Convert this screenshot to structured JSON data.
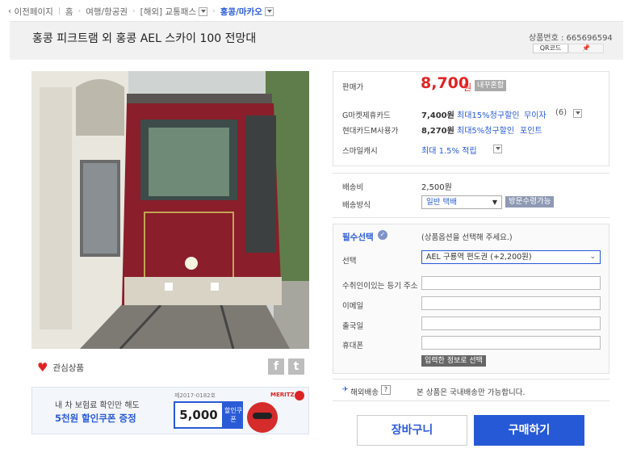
{
  "breadcrumb": {
    "back": "이전페이지",
    "items": [
      "홈",
      "여행/항공권",
      "[해외] 교통패스"
    ],
    "current": "홍콩/마카오"
  },
  "product": {
    "title": "홍콩 피크트램 외 홍콩 AEL 스카이 100 전망대",
    "number": "상품번호 : 665696594",
    "qr_label": "QR코드",
    "pin_label": "핀"
  },
  "price": {
    "label": "판매가",
    "value": "8,700",
    "unit": "원",
    "lowest_badge": "내꾸혼합"
  },
  "cards": [
    {
      "name": "G마켓제휴카드",
      "price": "7,400원",
      "benefit": "최대15%청구할인",
      "extra": "무이자",
      "count": "(6)"
    },
    {
      "name": "현대카드M사용가",
      "price": "8,270원",
      "benefit": "최대5%청구할인",
      "extra": "포인트"
    }
  ],
  "smile_cash": {
    "label": "스마일캐시",
    "value": "최대 1.5% 적립"
  },
  "shipping": {
    "fee_label": "배송비",
    "fee": "2,500원",
    "method_label": "배송방식",
    "method": "일반 택배",
    "pickup": "방문수령가능"
  },
  "option": {
    "required_label": "필수선택",
    "hint": "(상품옵션을 선택해 주세요.)",
    "select_label": "선택",
    "select_value": "AEL 구룡역 편도권 (+2,200원)",
    "fields": [
      "수취인이있는 등기 주소",
      "이메일",
      "출국일",
      "휴대폰"
    ],
    "confirm_button": "입력한 정보로 선택"
  },
  "overseas": {
    "label": "해외배송",
    "help": "?",
    "note": "본 상품은 국내배송만 가능합니다."
  },
  "actions": {
    "cart": "장바구니",
    "buy": "구매하기"
  },
  "wishlist": "관심상품",
  "banner": {
    "line1": "내 차 보험료 확인만 해도",
    "line2": "5천원 할인쿠폰 증정",
    "code": "제2017-0182호",
    "amount": "5,000",
    "coupon": "할인쿠폰",
    "brand": "MERITZ"
  },
  "colors": {
    "accent": "#2659d6",
    "price": "#e02424"
  }
}
